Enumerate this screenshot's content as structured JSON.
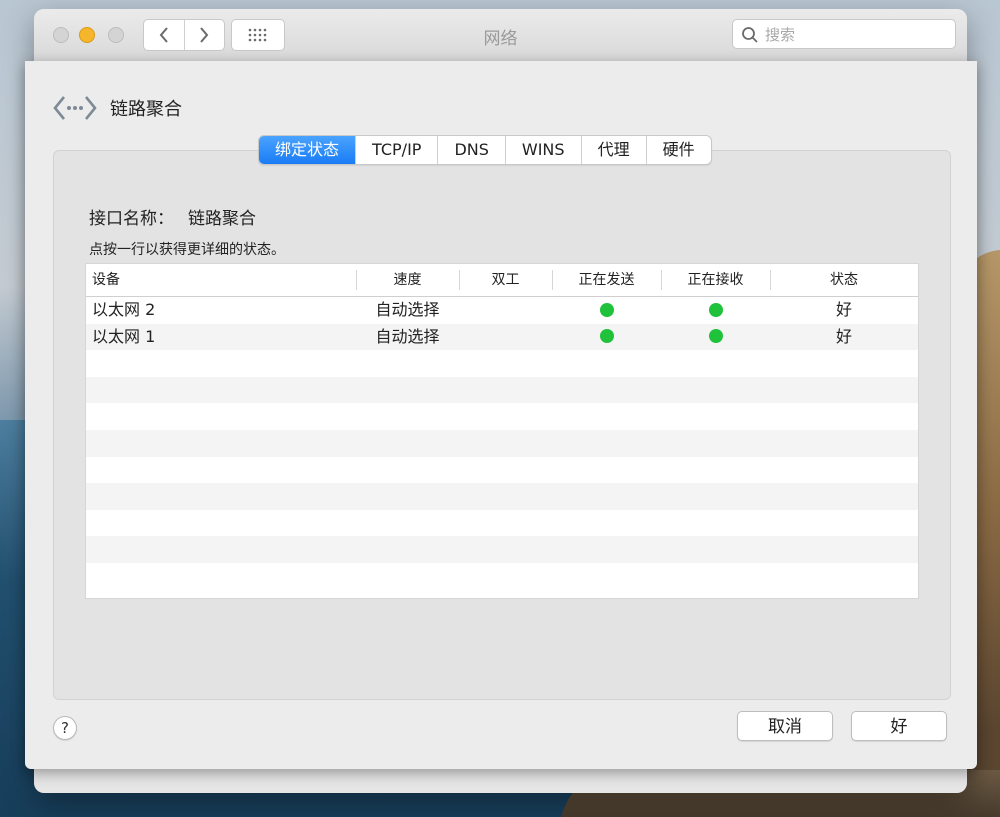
{
  "window": {
    "title": "网络",
    "search_placeholder": "搜索"
  },
  "sheet": {
    "title": "链路聚合",
    "tabs": [
      {
        "label": "绑定状态",
        "active": true
      },
      {
        "label": "TCP/IP",
        "active": false
      },
      {
        "label": "DNS",
        "active": false
      },
      {
        "label": "WINS",
        "active": false
      },
      {
        "label": "代理",
        "active": false
      },
      {
        "label": "硬件",
        "active": false
      }
    ],
    "interface_label": "接口名称：",
    "interface_value": "链路聚合",
    "hint": "点按一行以获得更详细的状态。",
    "table": {
      "columns": [
        "设备",
        "速度",
        "双工",
        "正在发送",
        "正在接收",
        "状态"
      ],
      "rows": [
        {
          "device": "以太网 2",
          "speed": "自动选择",
          "duplex": "",
          "sending": true,
          "receiving": true,
          "status": "好"
        },
        {
          "device": "以太网 1",
          "speed": "自动选择",
          "duplex": "",
          "sending": true,
          "receiving": true,
          "status": "好"
        }
      ],
      "empty_rows": 9
    },
    "help_label": "?",
    "cancel_label": "取消",
    "ok_label": "好"
  },
  "colors": {
    "accent": "#1a7cf5",
    "status_green": "#1fc23a",
    "minimize": "#f5b62b"
  }
}
